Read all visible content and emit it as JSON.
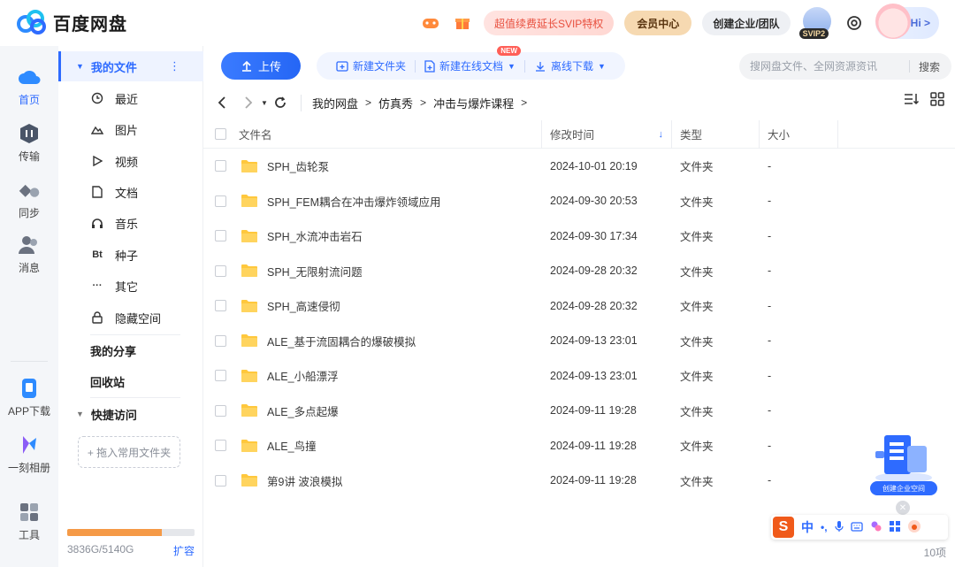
{
  "app": {
    "name": "百度网盘"
  },
  "header": {
    "svip_promo": "超值续费延长SVIP特权",
    "vip_center": "会员中心",
    "enterprise": "创建企业/团队",
    "svip_level": "SVIP2",
    "hi": "Hi >"
  },
  "rail": {
    "home": "首页",
    "transfer": "传输",
    "sync": "同步",
    "messages": "消息",
    "app_download": "APP下载",
    "album": "一刻相册",
    "tools": "工具"
  },
  "sidebar": {
    "my_files": "我的文件",
    "items": [
      {
        "label": "最近",
        "icon": "clock-icon"
      },
      {
        "label": "图片",
        "icon": "mountain-icon"
      },
      {
        "label": "视频",
        "icon": "play-icon"
      },
      {
        "label": "文档",
        "icon": "document-icon"
      },
      {
        "label": "音乐",
        "icon": "headphones-icon"
      },
      {
        "label": "种子",
        "icon": "bt-icon",
        "glyph": "Bt"
      },
      {
        "label": "其它",
        "icon": "more-icon",
        "glyph": "···"
      },
      {
        "label": "隐藏空间",
        "icon": "lock-icon"
      }
    ],
    "my_share": "我的分享",
    "recycle": "回收站",
    "quick_access": "快捷访问",
    "drag_hint": "+ 拖入常用文件夹",
    "storage_text": "3836G/5140G",
    "storage_fraction": 0.746,
    "expand": "扩容"
  },
  "toolbar": {
    "upload": "上传",
    "new_folder": "新建文件夹",
    "new_online_doc": "新建在线文档",
    "new_badge": "NEW",
    "offline_download": "离线下载",
    "search_placeholder": "搜网盘文件、全网资源资讯",
    "search_button": "搜索"
  },
  "breadcrumb": [
    "我的网盘",
    "仿真秀",
    "冲击与爆炸课程"
  ],
  "table": {
    "headers": {
      "name": "文件名",
      "modified": "修改时间",
      "type": "类型",
      "size": "大小"
    },
    "rows": [
      {
        "name": "SPH_齿轮泵",
        "modified": "2024-10-01 20:19",
        "type": "文件夹",
        "size": "-"
      },
      {
        "name": "SPH_FEM耦合在冲击爆炸领域应用",
        "modified": "2024-09-30 20:53",
        "type": "文件夹",
        "size": "-"
      },
      {
        "name": "SPH_水流冲击岩石",
        "modified": "2024-09-30 17:34",
        "type": "文件夹",
        "size": "-"
      },
      {
        "name": "SPH_无限射流问题",
        "modified": "2024-09-28 20:32",
        "type": "文件夹",
        "size": "-"
      },
      {
        "name": "SPH_高速侵彻",
        "modified": "2024-09-28 20:32",
        "type": "文件夹",
        "size": "-"
      },
      {
        "name": "ALE_基于流固耦合的爆破模拟",
        "modified": "2024-09-13 23:01",
        "type": "文件夹",
        "size": "-"
      },
      {
        "name": "ALE_小船漂浮",
        "modified": "2024-09-13 23:01",
        "type": "文件夹",
        "size": "-"
      },
      {
        "name": "ALE_多点起爆",
        "modified": "2024-09-11 19:28",
        "type": "文件夹",
        "size": "-"
      },
      {
        "name": "ALE_鸟撞",
        "modified": "2024-09-11 19:28",
        "type": "文件夹",
        "size": "-"
      },
      {
        "name": "第9讲 波浪模拟",
        "modified": "2024-09-11 19:28",
        "type": "文件夹",
        "size": "-"
      }
    ],
    "count": "10项"
  },
  "float": {
    "enterprise_space": "创建企业空间"
  },
  "ime": {
    "mode": "中",
    "punct": "•,"
  },
  "colors": {
    "accent": "#2e6bff",
    "folder": "#ffc83d",
    "storage": "#f59a47"
  }
}
